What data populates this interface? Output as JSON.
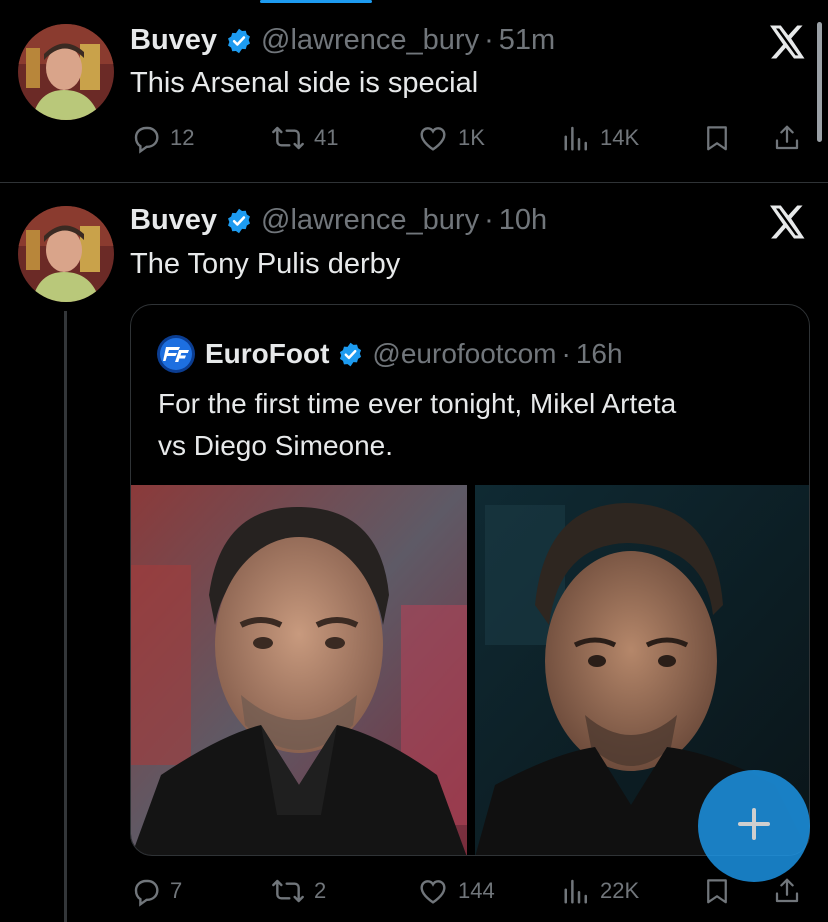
{
  "tweets": [
    {
      "author_name": "Buvey",
      "handle": "@lawrence_bury",
      "separator": "·",
      "time": "51m",
      "text": "This Arsenal side is special",
      "replies": "12",
      "reposts": "41",
      "likes": "1K",
      "views": "14K"
    },
    {
      "author_name": "Buvey",
      "handle": "@lawrence_bury",
      "separator": "·",
      "time": "10h",
      "text": "The Tony Pulis derby",
      "replies": "7",
      "reposts": "2",
      "likes": "144",
      "views": "22K",
      "quote": {
        "author_name": "EuroFoot",
        "handle": "@eurofootcom",
        "separator": "·",
        "time": "16h",
        "text_line1": "For the first time ever tonight, Mikel Arteta",
        "text_line2": "vs Diego Simeone."
      }
    }
  ],
  "colors": {
    "background": "#000000",
    "accent": "#1d9bf0",
    "muted_text": "#71767b",
    "primary_text": "#e7e9ea",
    "border": "#2f3336"
  },
  "icons": {
    "reply": "reply-icon",
    "repost": "repost-icon",
    "like": "heart-icon",
    "views": "views-icon",
    "bookmark": "bookmark-icon",
    "share": "share-icon",
    "verified": "verified-badge-icon",
    "brand": "x-logo-icon",
    "compose": "plus-icon"
  }
}
